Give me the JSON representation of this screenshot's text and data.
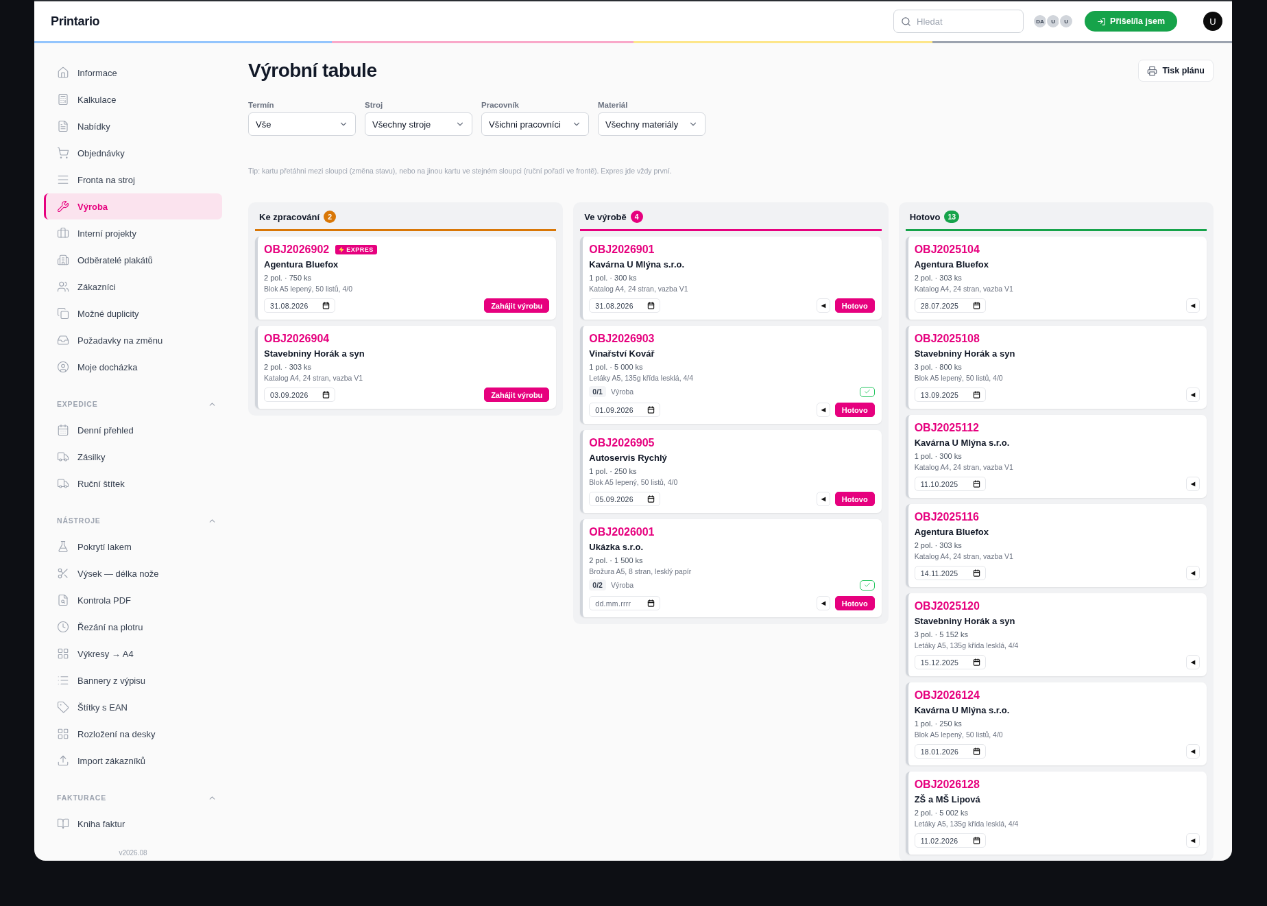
{
  "app": {
    "name": "Printario"
  },
  "topbar": {
    "search": {
      "placeholder": "Hledat"
    },
    "presence": [
      "DA",
      "U",
      "U"
    ],
    "checkin_button": "Přišel/la jsem",
    "user": "U"
  },
  "sidebar": {
    "items": [
      {
        "label": "Informace",
        "selected": false
      },
      {
        "label": "Kalkulace",
        "selected": false
      },
      {
        "label": "Nabídky",
        "selected": false
      },
      {
        "label": "Objednávky",
        "selected": false
      },
      {
        "label": "Fronta na stroj",
        "selected": false
      },
      {
        "label": "Výroba",
        "selected": true
      },
      {
        "label": "Interní projekty",
        "selected": false
      },
      {
        "label": "Odběratelé plakátů",
        "selected": false
      },
      {
        "label": "Zákazníci",
        "selected": false
      },
      {
        "label": "Možné duplicity",
        "selected": false
      },
      {
        "label": "Požadavky na změnu",
        "selected": false
      },
      {
        "label": "Moje docházka",
        "selected": false
      }
    ],
    "sections": [
      {
        "title": "EXPEDICE",
        "expanded": true,
        "items": [
          {
            "label": "Denní přehled",
            "selected": false
          },
          {
            "label": "Zásilky",
            "selected": false
          },
          {
            "label": "Ruční štítek",
            "selected": false
          }
        ]
      },
      {
        "title": "NÁSTROJE",
        "expanded": true,
        "items": [
          {
            "label": "Pokrytí lakem",
            "selected": false
          },
          {
            "label": "Výsek — délka nože",
            "selected": false
          },
          {
            "label": "Kontrola PDF",
            "selected": false
          },
          {
            "label": "Řezání na plotru",
            "selected": false
          },
          {
            "label": "Výkresy → A4",
            "selected": false
          },
          {
            "label": "Bannery z výpisu",
            "selected": false
          },
          {
            "label": "Štítky s EAN",
            "selected": false
          },
          {
            "label": "Rozložení na desky",
            "selected": false
          },
          {
            "label": "Import zákazníků",
            "selected": false
          }
        ]
      },
      {
        "title": "FAKTURACE",
        "expanded": true,
        "items": [
          {
            "label": "Kniha faktur",
            "selected": false
          }
        ]
      }
    ],
    "version": "v2026.08"
  },
  "page": {
    "title": "Výrobní tabule",
    "print_button": "Tisk plánu",
    "filters": [
      {
        "label": "Termín",
        "value": "Vše"
      },
      {
        "label": "Stroj",
        "value": "Všechny stroje"
      },
      {
        "label": "Pracovník",
        "value": "Všichni pracovníci"
      },
      {
        "label": "Materiál",
        "value": "Všechny materiály"
      }
    ],
    "tip": "Tip: kartu přetáhni mezi sloupci (změna stavu), nebo na jinou kartu ve stejném sloupci (ruční pořadí ve frontě). Expres jde vždy první."
  },
  "board": {
    "columns": [
      {
        "title": "Ke zpracování",
        "count": "2",
        "color": "#d97706",
        "cards": [
          {
            "id": "OBJ2026902",
            "badge": "EXPRES",
            "customer": "Agentura Bluefox",
            "quantity": "2 pol. · 750 ks",
            "product": "Blok A5 lepený, 50 listů, 4/0",
            "date": {
              "value": "31.08.2026"
            },
            "actions": [
              {
                "kind": "primary",
                "label": "Zahájit výrobu"
              }
            ]
          },
          {
            "id": "OBJ2026904",
            "customer": "Stavebniny Horák a syn",
            "quantity": "2 pol. · 303 ks",
            "product": "Katalog A4, 24 stran, vazba V1",
            "date": {
              "value": "03.09.2026"
            },
            "actions": [
              {
                "kind": "primary",
                "label": "Zahájit výrobu"
              }
            ]
          }
        ]
      },
      {
        "title": "Ve výrobě",
        "count": "4",
        "color": "#e6007e",
        "cards": [
          {
            "id": "OBJ2026901",
            "customer": "Kavárna U Mlýna s.r.o.",
            "quantity": "1 pol. · 300 ks",
            "product": "Katalog A4, 24 stran, vazba V1",
            "date": {
              "value": "31.08.2026"
            },
            "actions": [
              {
                "kind": "back",
                "label": "◀"
              },
              {
                "kind": "primary",
                "label": "Hotovo"
              }
            ]
          },
          {
            "id": "OBJ2026903",
            "customer": "Vinařství Kovář",
            "quantity": "1 pol. · 5 000 ks",
            "product": "Letáky A5, 135g křída lesklá, 4/4",
            "progress": {
              "count": "0/1",
              "label": "Výroba",
              "checked": true
            },
            "date": {
              "value": "01.09.2026"
            },
            "actions": [
              {
                "kind": "back",
                "label": "◀"
              },
              {
                "kind": "primary",
                "label": "Hotovo"
              }
            ]
          },
          {
            "id": "OBJ2026905",
            "customer": "Autoservis Rychlý",
            "quantity": "1 pol. · 250 ks",
            "product": "Blok A5 lepený, 50 listů, 4/0",
            "date": {
              "value": "05.09.2026"
            },
            "actions": [
              {
                "kind": "back",
                "label": "◀"
              },
              {
                "kind": "primary",
                "label": "Hotovo"
              }
            ]
          },
          {
            "id": "OBJ2026001",
            "customer": "Ukázka s.r.o.",
            "quantity": "2 pol. · 1 500 ks",
            "product": "Brožura A5, 8 stran, lesklý papír",
            "progress": {
              "count": "0/2",
              "label": "Výroba",
              "checked": true
            },
            "date": {
              "placeholder": "dd.mm.rrrr"
            },
            "actions": [
              {
                "kind": "back",
                "label": "◀"
              },
              {
                "kind": "primary",
                "label": "Hotovo"
              }
            ]
          }
        ]
      },
      {
        "title": "Hotovo",
        "count": "13",
        "color": "#16a34a",
        "cards": [
          {
            "id": "OBJ2025104",
            "customer": "Agentura Bluefox",
            "quantity": "2 pol. · 303 ks",
            "product": "Katalog A4, 24 stran, vazba V1",
            "date": {
              "value": "28.07.2025"
            },
            "actions": [
              {
                "kind": "back",
                "label": "◀"
              }
            ]
          },
          {
            "id": "OBJ2025108",
            "customer": "Stavebniny Horák a syn",
            "quantity": "3 pol. · 800 ks",
            "product": "Blok A5 lepený, 50 listů, 4/0",
            "date": {
              "value": "13.09.2025"
            },
            "actions": [
              {
                "kind": "back",
                "label": "◀"
              }
            ]
          },
          {
            "id": "OBJ2025112",
            "customer": "Kavárna U Mlýna s.r.o.",
            "quantity": "1 pol. · 300 ks",
            "product": "Katalog A4, 24 stran, vazba V1",
            "date": {
              "value": "11.10.2025"
            },
            "actions": [
              {
                "kind": "back",
                "label": "◀"
              }
            ]
          },
          {
            "id": "OBJ2025116",
            "customer": "Agentura Bluefox",
            "quantity": "2 pol. · 303 ks",
            "product": "Katalog A4, 24 stran, vazba V1",
            "date": {
              "value": "14.11.2025"
            },
            "actions": [
              {
                "kind": "back",
                "label": "◀"
              }
            ]
          },
          {
            "id": "OBJ2025120",
            "customer": "Stavebniny Horák a syn",
            "quantity": "3 pol. · 5 152 ks",
            "product": "Letáky A5, 135g křída lesklá, 4/4",
            "date": {
              "value": "15.12.2025"
            },
            "actions": [
              {
                "kind": "back",
                "label": "◀"
              }
            ]
          },
          {
            "id": "OBJ2026124",
            "customer": "Kavárna U Mlýna s.r.o.",
            "quantity": "1 pol. · 250 ks",
            "product": "Blok A5 lepený, 50 listů, 4/0",
            "date": {
              "value": "18.01.2026"
            },
            "actions": [
              {
                "kind": "back",
                "label": "◀"
              }
            ]
          },
          {
            "id": "OBJ2026128",
            "customer": "ZŠ a MŠ Lipová",
            "quantity": "2 pol. · 5 002 ks",
            "product": "Letáky A5, 135g křída lesklá, 4/4",
            "date": {
              "value": "11.02.2026"
            },
            "actions": [
              {
                "kind": "back",
                "label": "◀"
              }
            ]
          }
        ]
      }
    ]
  }
}
